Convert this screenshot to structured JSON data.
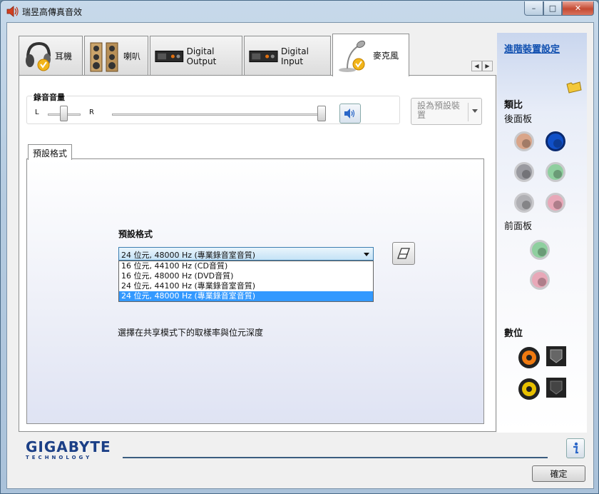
{
  "window": {
    "title": "瑞昱高傳真音效",
    "title_icon": "speaker-icon",
    "caption": {
      "minimize": "–",
      "maximize": "□",
      "close": "✕"
    }
  },
  "tabs": [
    {
      "label": "耳機",
      "icon": "headphones-icon",
      "active": false
    },
    {
      "label": "喇叭",
      "icon": "speakers-icon",
      "active": false
    },
    {
      "label": "Digital Output",
      "icon": "digital-output-icon",
      "active": false
    },
    {
      "label": "Digital Input",
      "icon": "digital-input-icon",
      "active": false
    },
    {
      "label": "麥克風",
      "icon": "microphone-icon",
      "active": true
    }
  ],
  "recording_volume": {
    "title": "錄音音量",
    "left_label": "L",
    "right_label": "R",
    "balance_level": 0.5,
    "volume_level": 1.0
  },
  "set_default_button": "設為預設裝置",
  "inner_tab": "預設格式",
  "default_format": {
    "label": "預設格式",
    "selected": "24 位元, 48000 Hz (專業錄音室音質)",
    "options": [
      "16 位元, 44100 Hz (CD音質)",
      "16 位元, 48000 Hz (DVD音質)",
      "24 位元, 44100 Hz (專業錄音室音質)",
      "24 位元, 48000 Hz (專業錄音室音質)"
    ],
    "highlighted_index": 3,
    "description": "選擇在共享模式下的取樣率與位元深度"
  },
  "right_pane": {
    "advanced_link": "進階裝置設定",
    "output_section": "類比",
    "rear_panel": "後面板",
    "front_panel": "前面板",
    "digital_section": "數位",
    "colors": {
      "rear_orange": "#d9a58a",
      "rear_blue": "#1050c8",
      "rear_gray_1": "#9a9aa0",
      "rear_green": "#8fcf9f",
      "rear_gray_2": "#b0b0b4",
      "rear_pink": "#e8a8b8",
      "front_green": "#8fcf9f",
      "front_pink": "#e8a8b8",
      "digital_orange": "#f07a10",
      "digital_yellow": "#e8c000"
    }
  },
  "logo": {
    "brand": "GIGABYTE",
    "sub": "TECHNOLOGY"
  },
  "ok_button": "確定"
}
